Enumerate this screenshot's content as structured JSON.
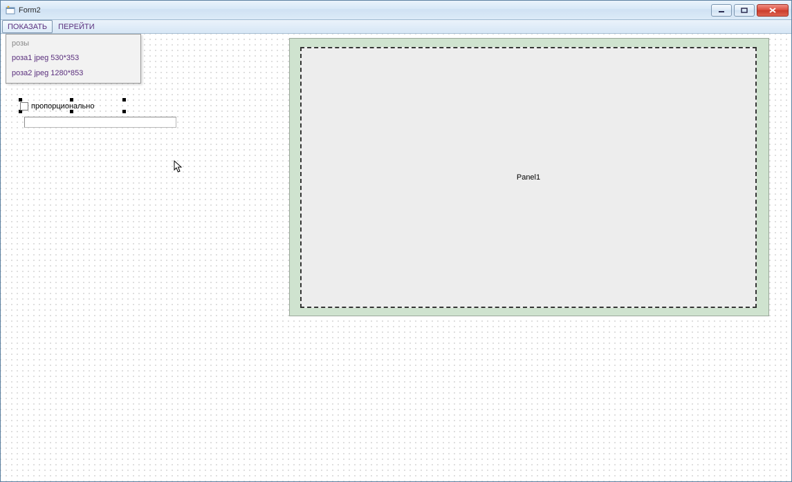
{
  "window": {
    "title": "Form2"
  },
  "menubar": {
    "items": [
      {
        "label": "ПОКАЗАТЬ",
        "active": true
      },
      {
        "label": "ПЕРЕЙТИ",
        "active": false
      }
    ]
  },
  "dropdown": {
    "header": "розы",
    "items": [
      "роза1 jpeg 530*353",
      "роза2 jpeg 1280*853"
    ]
  },
  "checkbox": {
    "label": "пропорционально"
  },
  "panel": {
    "caption": "Panel1"
  },
  "colors": {
    "titlebar_text": "#2b2b2b",
    "menu_text": "#5a2f7d",
    "panel_bg": "#cfe3cf",
    "inner_panel_bg": "#ededed"
  }
}
